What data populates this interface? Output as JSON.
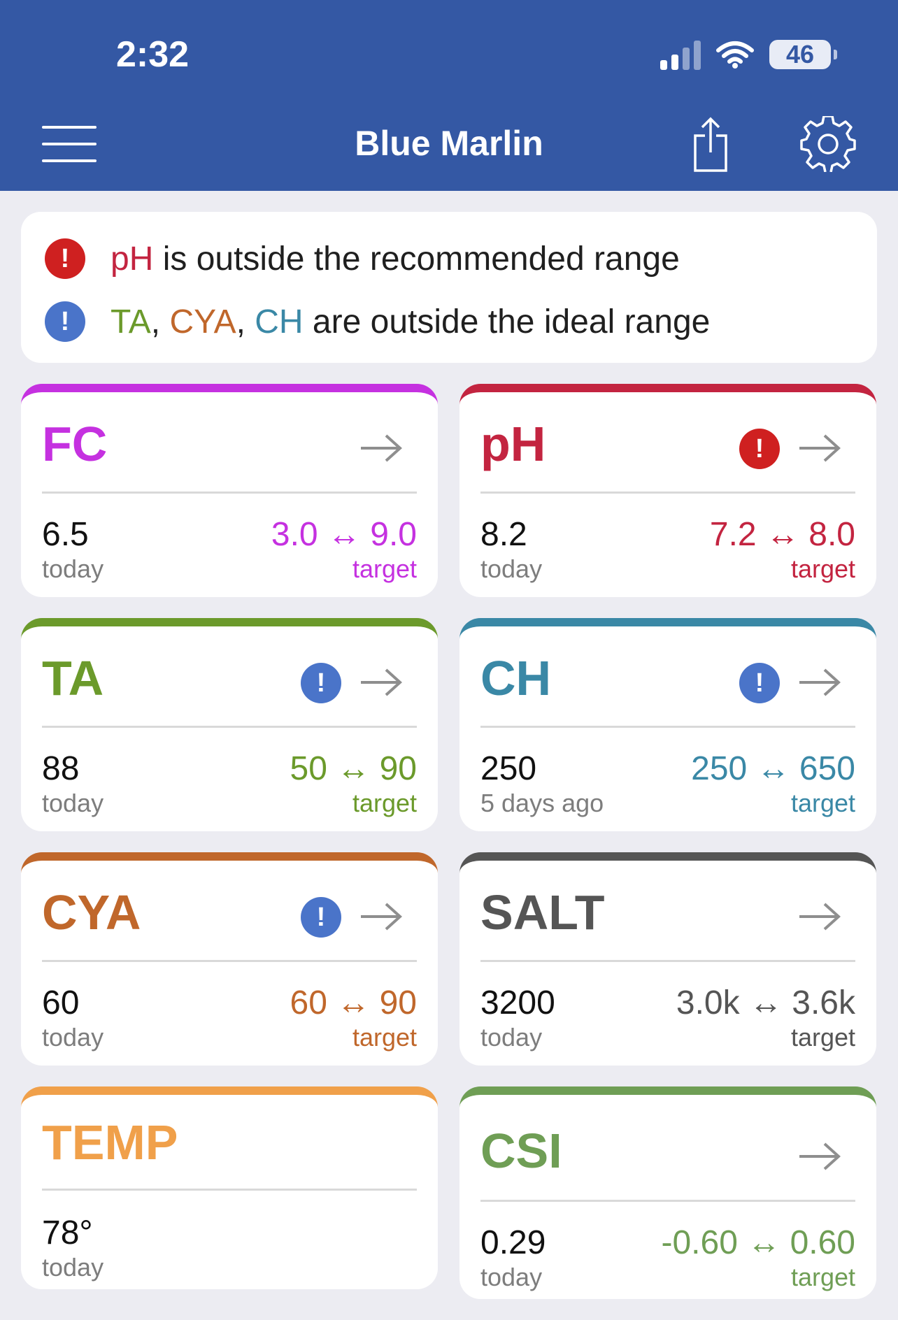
{
  "status_bar": {
    "time": "2:32",
    "battery": "46"
  },
  "header": {
    "title": "Blue Marlin"
  },
  "alerts": {
    "error_message": {
      "params": [
        {
          "name": "pH",
          "color": "#c32440"
        }
      ],
      "text": " is outside the recommended range"
    },
    "info_message": {
      "params": [
        {
          "name": "TA",
          "color": "#6b9a2b"
        },
        {
          "name": "CYA",
          "color": "#c0672b"
        },
        {
          "name": "CH",
          "color": "#3a88a6"
        }
      ],
      "text": " are outside the ideal range"
    }
  },
  "cards": {
    "fc": {
      "name": "FC",
      "value": "6.5",
      "when": "today",
      "range": "3.0 ↔ 9.0",
      "target": "target",
      "color": "#c531e0"
    },
    "ph": {
      "name": "pH",
      "value": "8.2",
      "when": "today",
      "range": "7.2 ↔ 8.0",
      "target": "target",
      "color": "#c32440",
      "badge": "error"
    },
    "ta": {
      "name": "TA",
      "value": "88",
      "when": "today",
      "range": "50 ↔ 90",
      "target": "target",
      "color": "#6b9a2b",
      "badge": "info"
    },
    "ch": {
      "name": "CH",
      "value": "250",
      "when": "5 days ago",
      "range": "250 ↔ 650",
      "target": "target",
      "color": "#3a88a6",
      "badge": "info"
    },
    "cya": {
      "name": "CYA",
      "value": "60",
      "when": "today",
      "range": "60 ↔ 90",
      "target": "target",
      "color": "#c0672b",
      "badge": "info"
    },
    "salt": {
      "name": "SALT",
      "value": "3200",
      "when": "today",
      "range": "3.0k ↔ 3.6k",
      "target": "target",
      "color": "#555555"
    },
    "temp": {
      "name": "TEMP",
      "value": "78°",
      "when": "today",
      "color": "#f0a04a"
    },
    "csi": {
      "name": "CSI",
      "value": "0.29",
      "when": "today",
      "range": "-0.60 ↔ 0.60",
      "target": "target",
      "color": "#6f9e55"
    }
  },
  "icons": {
    "menu": "hamburger-icon",
    "share": "share-icon",
    "settings": "gear-icon",
    "arrow": "arrow-right-icon",
    "alert": "exclamation-icon"
  }
}
